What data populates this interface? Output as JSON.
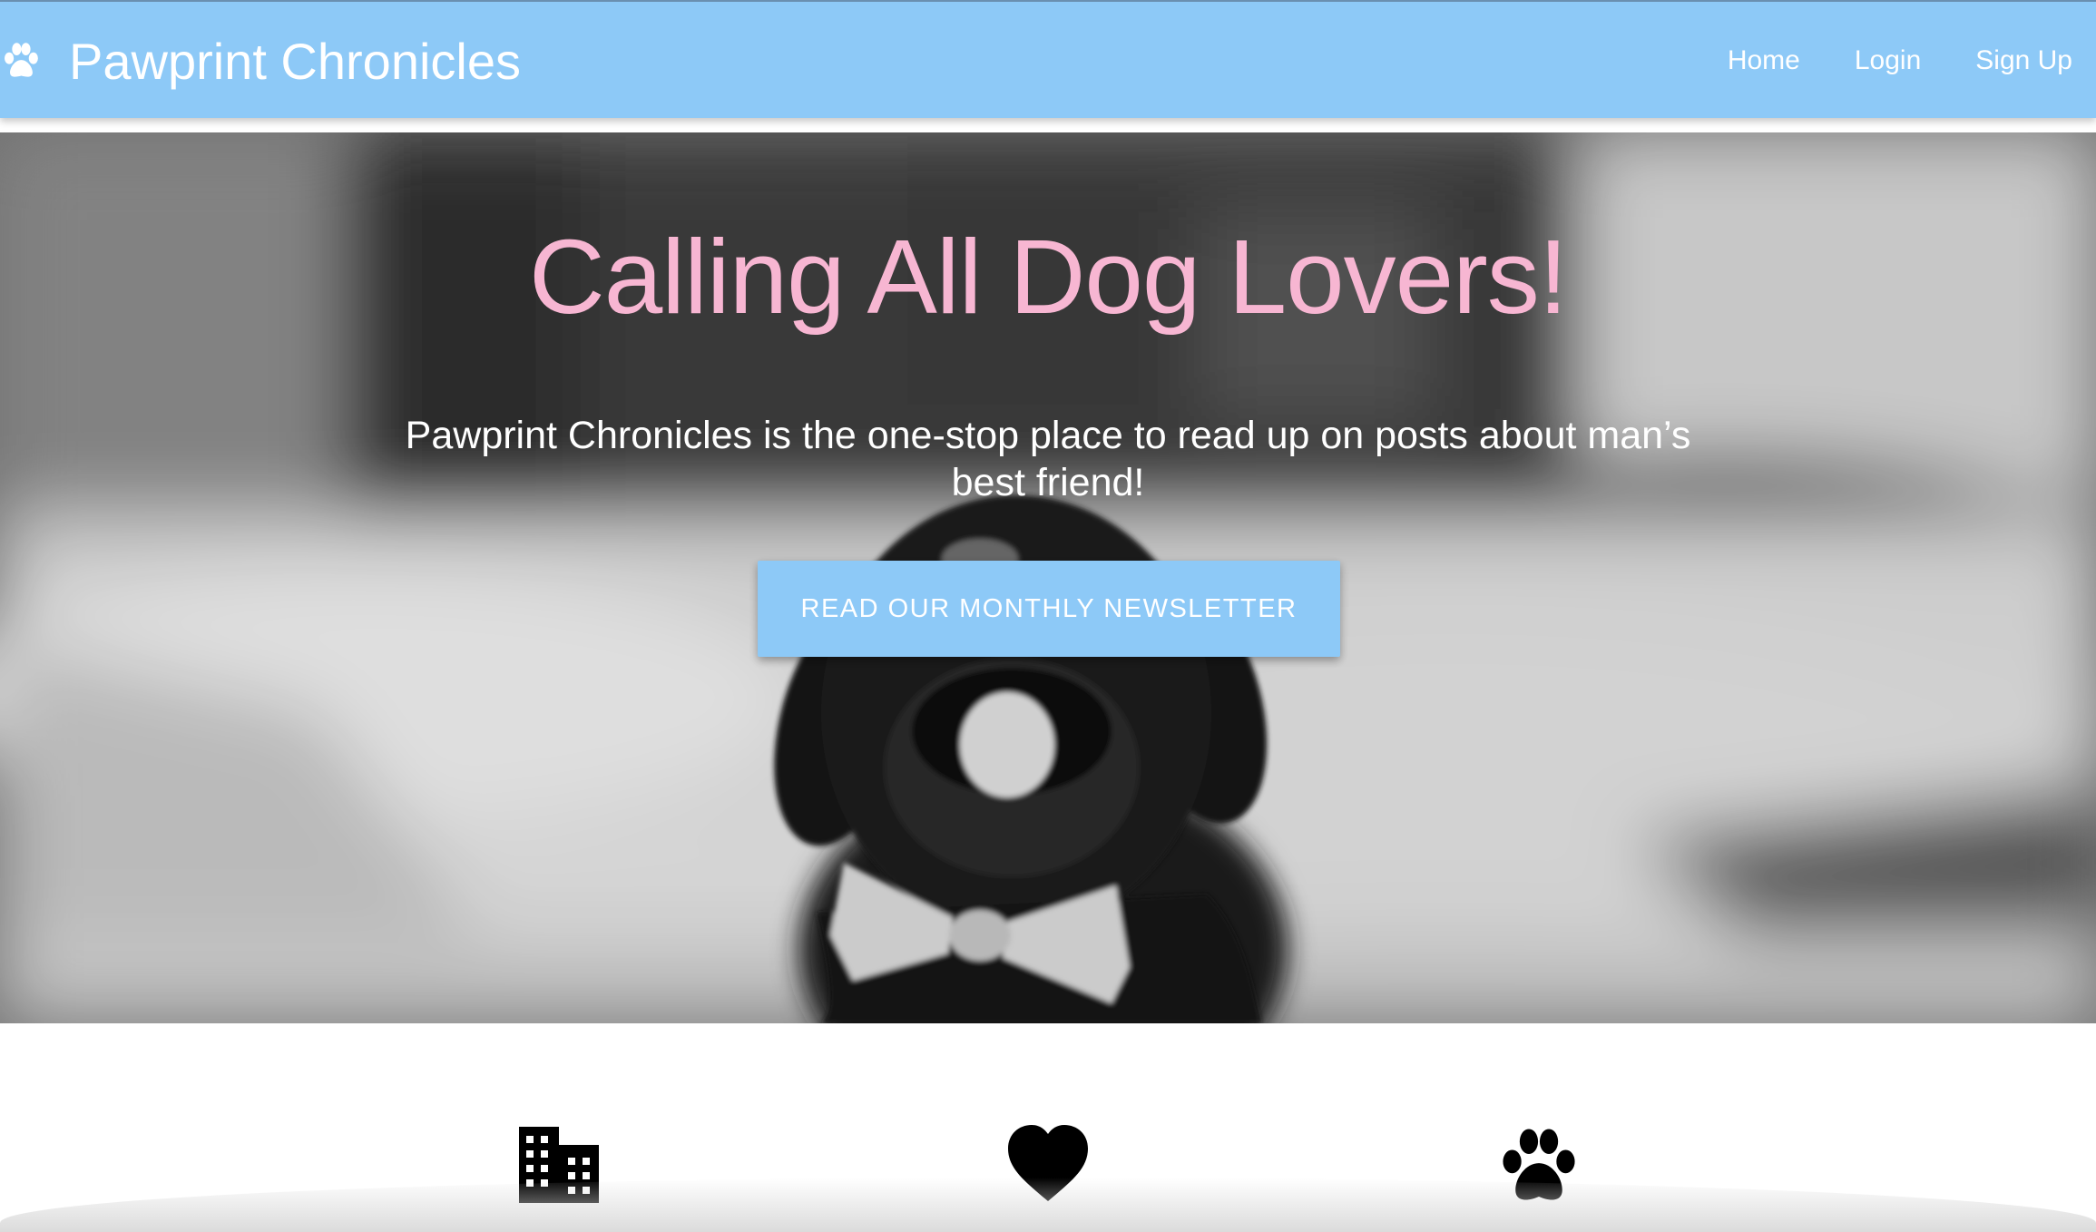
{
  "navbar": {
    "brand_icon": "paw-icon",
    "brand_title": "Pawprint Chronicles",
    "links": [
      {
        "label": "Home"
      },
      {
        "label": "Login"
      },
      {
        "label": "Sign Up"
      }
    ],
    "background_color": "#8dc9f7"
  },
  "hero": {
    "heading": "Calling All Dog Lovers!",
    "subheading": "Pawprint Chronicles is the one-stop place to read up on posts about man’s best friend!",
    "button_label": "READ OUR MONTHLY NEWSLETTER",
    "heading_color": "#f7b6d2",
    "button_color": "#8dc9f7",
    "image_subject": "black puppy wearing a white bow tie, black-and-white photo"
  },
  "features": {
    "icons": [
      {
        "name": "building-icon"
      },
      {
        "name": "heart-icon"
      },
      {
        "name": "paw-icon"
      }
    ]
  }
}
